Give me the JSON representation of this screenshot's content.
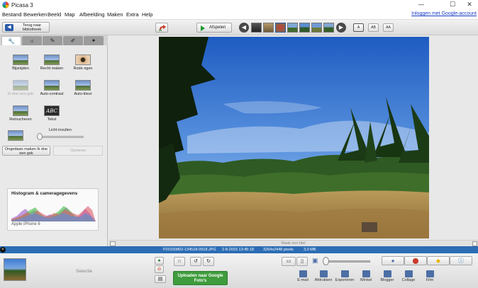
{
  "window": {
    "title": "Picasa 3",
    "min_glyph": "—",
    "max_glyph": "☐",
    "close_glyph": "✕"
  },
  "menu": {
    "items": [
      "Bestand",
      "Bewerken",
      "Beeld",
      "Map",
      "Afbeelding",
      "Maken",
      "Extra",
      "Help"
    ],
    "login_link": "Inloggen met Google-account"
  },
  "toolbar": {
    "back_label": "Terug naar bibliotheek",
    "play_label": "Afspelen",
    "view_buttons": [
      "A",
      "AB",
      "AA"
    ]
  },
  "tabs": [
    {
      "icon": "wrench-icon",
      "glyph": "🔧"
    },
    {
      "icon": "sun-icon",
      "glyph": "☼"
    },
    {
      "icon": "brush-icon",
      "glyph": "✎"
    },
    {
      "icon": "palette-icon",
      "glyph": "✐"
    },
    {
      "icon": "effects-icon",
      "glyph": "✦"
    }
  ],
  "tools": {
    "crop": "Bijsnijden",
    "straighten": "Recht maken",
    "redeye": "Rode ogen",
    "feeling_lucky": "Ik doe een gok",
    "auto_contrast": "Auto-contrast",
    "auto_color": "Auto-kleur",
    "retouch": "Retoucheren",
    "text": "Tekst",
    "fill_light": "Licht invullen",
    "text_icon": "ABC"
  },
  "panel": {
    "undo_label": "Ongedaan maken Ik doe een gok",
    "options_label": "Opnieuw",
    "histogram_title": "Histogram & cameragegevens",
    "camera_model": "Apple iPhone 6"
  },
  "caption": "Maak een titel",
  "info": {
    "filename": "P20150802-134518-0918.JPG",
    "date": "2-8-2015 13:45:18",
    "dimensions": "3264x2448 pixels",
    "size": "3,0 MB"
  },
  "tray": {
    "selection_label": "Selectie",
    "upload_label": "Uploaden naar Google Foto's",
    "actions": [
      "E-mail",
      "Afdrukken",
      "Exporteren",
      "Winkel",
      "Blogger",
      "Collage",
      "Film"
    ]
  },
  "colors": {
    "infobar": "#2c6db5",
    "upload_button": "#3f9c3c",
    "link": "#1a3cc8"
  }
}
